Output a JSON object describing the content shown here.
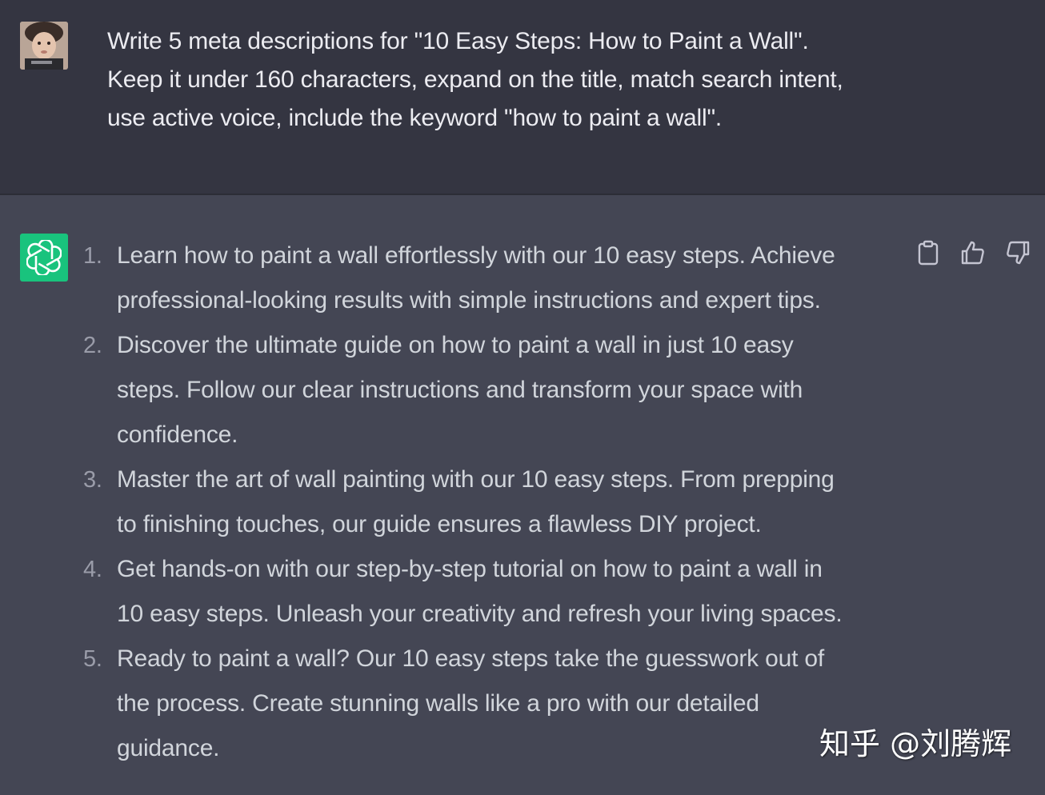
{
  "user_message": {
    "lines": [
      "Write 5 meta descriptions for \"10 Easy Steps: How to Paint a Wall\".",
      "Keep it under 160 characters, expand on the title, match search intent,",
      "use active voice, include the keyword \"how to paint a wall\"."
    ]
  },
  "assistant_message": {
    "items": [
      {
        "number": "1.",
        "lines": [
          "Learn how to paint a wall effortlessly with our 10 easy steps. Achieve",
          "professional-looking results with simple instructions and expert tips."
        ]
      },
      {
        "number": "2.",
        "lines": [
          "Discover the ultimate guide on how to paint a wall in just 10 easy",
          "steps. Follow our clear instructions and transform your space with",
          "confidence."
        ]
      },
      {
        "number": "3.",
        "lines": [
          "Master the art of wall painting with our 10 easy steps. From prepping",
          "to finishing touches, our guide ensures a flawless DIY project."
        ]
      },
      {
        "number": "4.",
        "lines": [
          "Get hands-on with our step-by-step tutorial on how to paint a wall in",
          "10 easy steps. Unleash your creativity and refresh your living spaces."
        ]
      },
      {
        "number": "5.",
        "lines": [
          "Ready to paint a wall? Our 10 easy steps take the guesswork out of",
          "the process. Create stunning walls like a pro with our detailed",
          "guidance."
        ]
      }
    ]
  },
  "actions": [
    "copy-icon",
    "thumbs-up-icon",
    "thumbs-down-icon"
  ],
  "watermark": "知乎 @刘腾辉",
  "colors": {
    "user_bg": "#343541",
    "assistant_bg": "#444654",
    "logo_green": "#19c37d",
    "text": "#d1d5db"
  }
}
